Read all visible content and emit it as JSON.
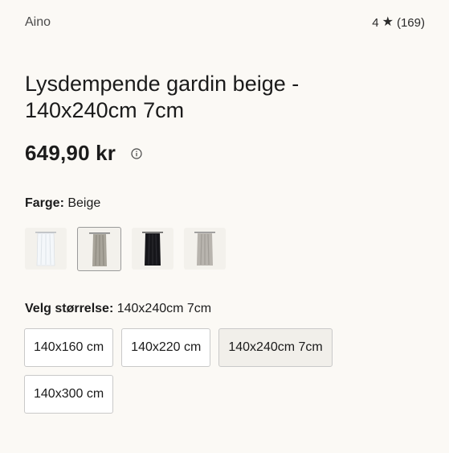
{
  "header": {
    "brand": "Aino",
    "rating_value": "4",
    "rating_count": "(169)"
  },
  "product": {
    "title": "Lysdempende gardin beige - 140x240cm 7cm",
    "price": "649,90 kr"
  },
  "color": {
    "label": "Farge:",
    "value": "Beige",
    "swatches": [
      {
        "name": "white",
        "color": "#e8ecef",
        "accent": "#ffffff"
      },
      {
        "name": "beige",
        "color": "#a8a49a",
        "accent": "#8e8a80"
      },
      {
        "name": "black",
        "color": "#16161a",
        "accent": "#2a2a30"
      },
      {
        "name": "grey",
        "color": "#b8b4ae",
        "accent": "#a09c96"
      }
    ]
  },
  "size": {
    "label": "Velg størrelse:",
    "value": "140x240cm 7cm",
    "options": [
      "140x160 cm",
      "140x220 cm",
      "140x240cm 7cm",
      "140x300 cm"
    ],
    "selected_index": 2
  }
}
